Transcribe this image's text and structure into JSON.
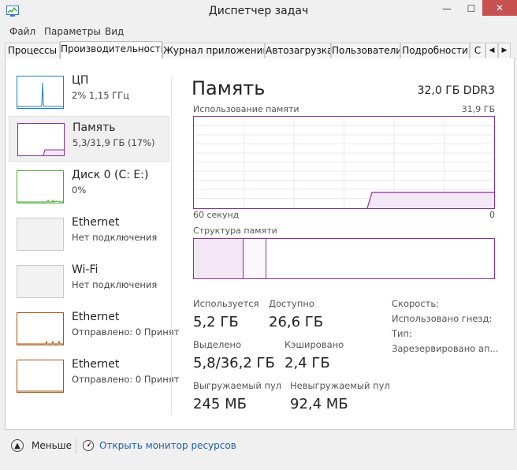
{
  "window": {
    "title": "Диспетчер задач",
    "icon": "task-manager-icon"
  },
  "menu": [
    "Файл",
    "Параметры",
    "Вид"
  ],
  "tabs": [
    "Процессы",
    "Производительность",
    "Журнал приложений",
    "Автозагрузка",
    "Пользователи",
    "Подробности",
    "С"
  ],
  "sidebar": [
    {
      "name": "ЦП",
      "sub": "2% 1,15 ГГц",
      "color": "#1782c1"
    },
    {
      "name": "Память",
      "sub": "5,3/31,9 ГБ (17%)",
      "color": "#8b2f9c"
    },
    {
      "name": "Диск 0 (C: E:)",
      "sub": "0%",
      "color": "#4da833"
    },
    {
      "name": "Ethernet",
      "sub": "Нет подключения",
      "color": "#a7a7a7"
    },
    {
      "name": "Wi-Fi",
      "sub": "Нет подключения",
      "color": "#a7a7a7"
    },
    {
      "name": "Ethernet",
      "sub": "Отправлено: 0 Принят",
      "color": "#a75a14"
    },
    {
      "name": "Ethernet",
      "sub": "Отправлено: 0 Принят",
      "color": "#a75a14"
    }
  ],
  "main": {
    "title": "Память",
    "total": "32,0 ГБ DDR3",
    "usage_label": "Использование памяти",
    "usage_max": "31,9 ГБ",
    "time_left": "60 секунд",
    "time_right": "0",
    "structure_label": "Структура памяти"
  },
  "stats": {
    "in_use_label": "Используется",
    "in_use_value": "5,2 ГБ",
    "available_label": "Доступно",
    "available_value": "26,6 ГБ",
    "committed_label": "Выделено",
    "committed_value": "5,8/36,2 ГБ",
    "cached_label": "Кэшировано",
    "cached_value": "2,4 ГБ",
    "paged_label": "Выгружаемый пул",
    "paged_value": "245 МБ",
    "nonpaged_label": "Невыгружаемый пул",
    "nonpaged_value": "92,4 МБ",
    "speed_label": "Скорость:",
    "slots_label": "Использовано гнезд:",
    "type_label": "Тип:",
    "reserved_label": "Зарезервировано ап..."
  },
  "footer": {
    "less": "Меньше",
    "monitor": "Открыть монитор ресурсов"
  }
}
